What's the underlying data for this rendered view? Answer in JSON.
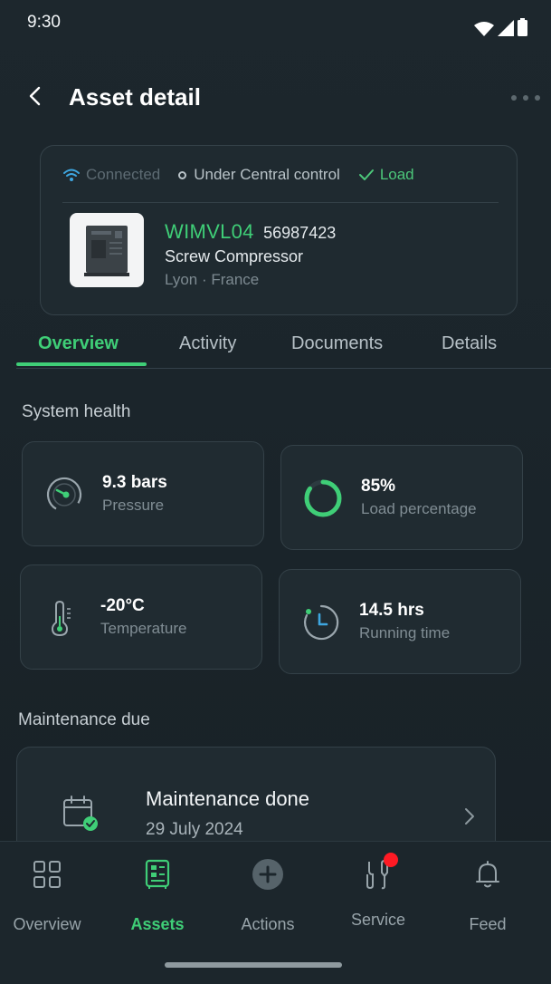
{
  "status_bar": {
    "time": "9:30"
  },
  "header": {
    "title": "Asset detail"
  },
  "asset": {
    "connection": "Connected",
    "control": "Under Central control",
    "load_state": "Load",
    "name": "WIMVL04",
    "serial": "56987423",
    "type": "Screw Compressor",
    "location": "Lyon · France"
  },
  "tabs": [
    {
      "label": "Overview",
      "active": true
    },
    {
      "label": "Activity"
    },
    {
      "label": "Documents"
    },
    {
      "label": "Details"
    }
  ],
  "system_health": {
    "label": "System health",
    "metrics": [
      {
        "value": "9.3 bars",
        "label": "Pressure",
        "icon": "gauge-icon"
      },
      {
        "value": "85%",
        "label": "Load percentage",
        "icon": "progress-ring-icon",
        "level": 0.85
      },
      {
        "value": "-20°C",
        "label": "Temperature",
        "icon": "thermometer-icon"
      },
      {
        "value": "14.5 hrs",
        "label": "Running time",
        "icon": "clock-icon"
      }
    ]
  },
  "maintenance": {
    "label": "Maintenance due",
    "title": "Maintenance done",
    "date": "29 July 2024"
  },
  "bottom_nav": [
    {
      "label": "Overview",
      "icon": "grid-icon"
    },
    {
      "label": "Assets",
      "icon": "assets-icon",
      "active": true
    },
    {
      "label": "Actions",
      "icon": "plus-circle-icon"
    },
    {
      "label": "Service",
      "icon": "wrench-icon",
      "badge": true
    },
    {
      "label": "Feed",
      "icon": "bell-icon"
    }
  ],
  "colors": {
    "accent": "#3fce77",
    "badge": "#ff1a24",
    "wifi": "#3ea6e0"
  }
}
